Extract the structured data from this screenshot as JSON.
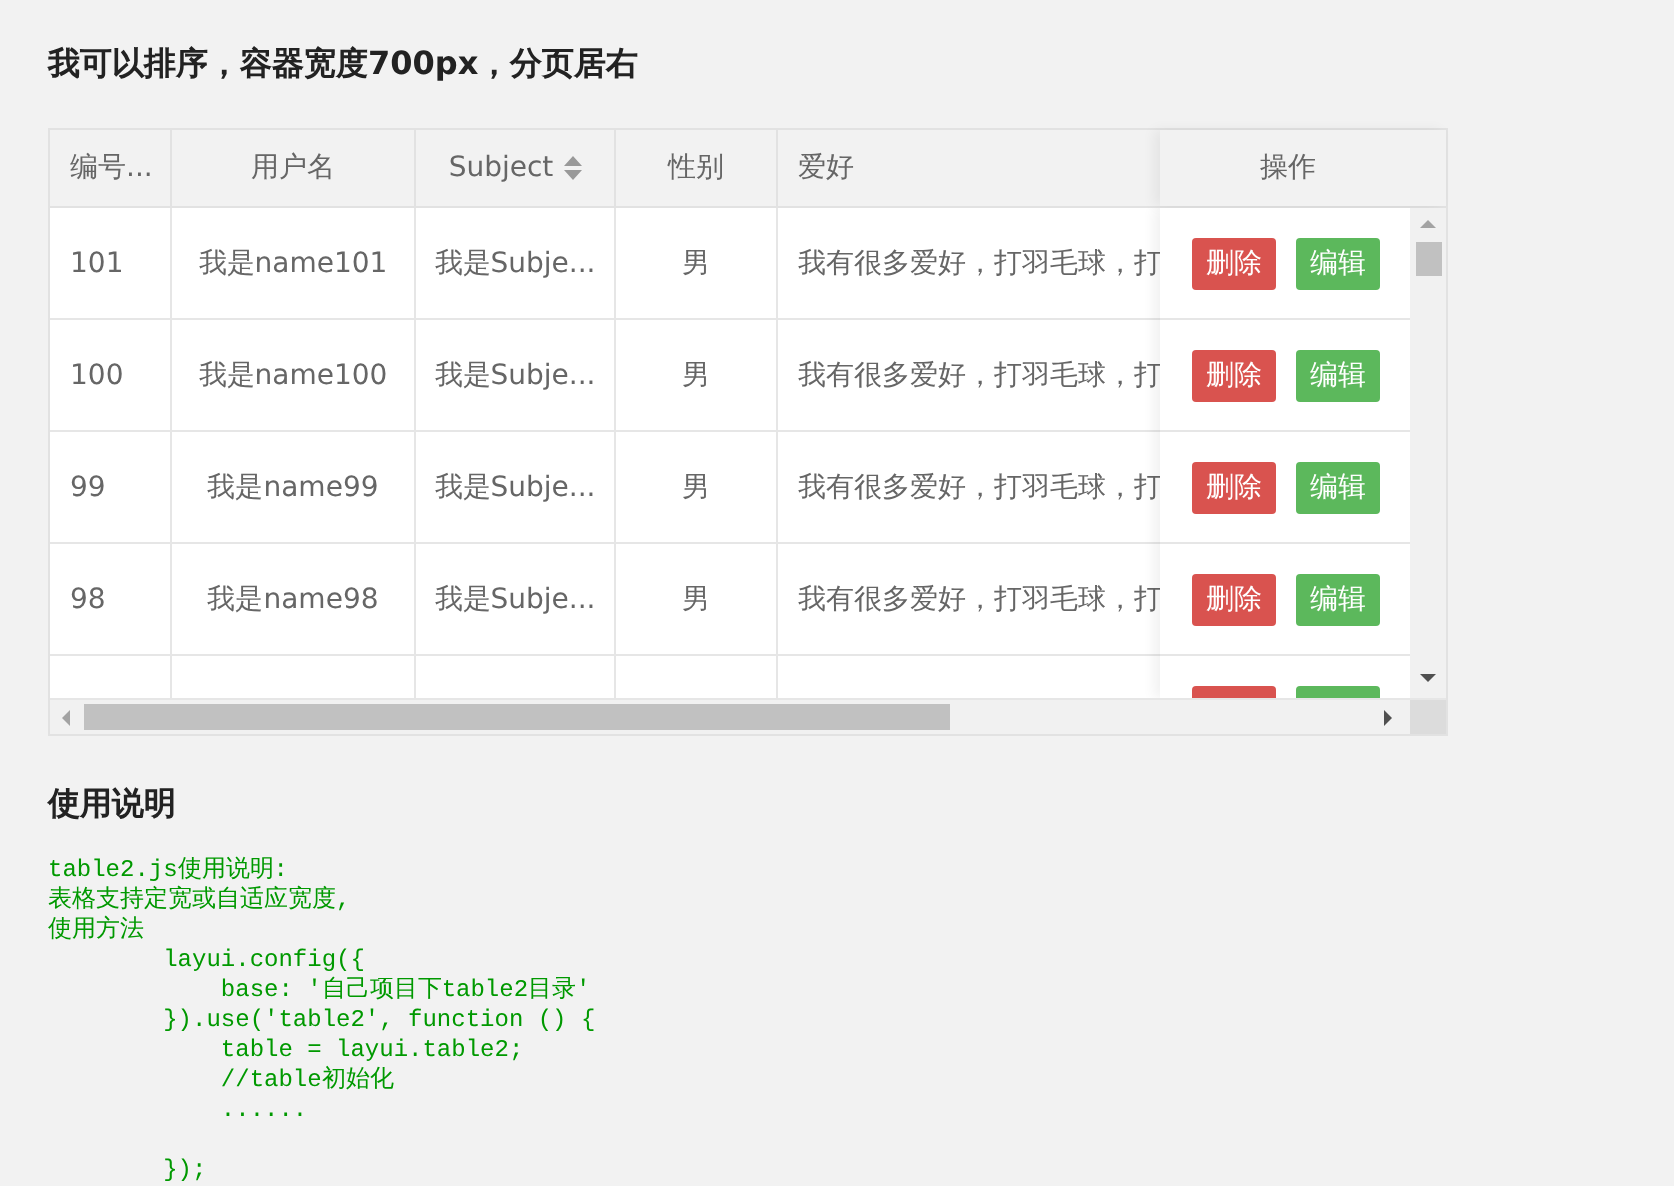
{
  "title": "我可以排序，容器宽度700px，分页居右",
  "table": {
    "columns": [
      {
        "label": "编号..."
      },
      {
        "label": "用户名"
      },
      {
        "label": "Subject",
        "sortable": true
      },
      {
        "label": "性别"
      },
      {
        "label": "爱好"
      }
    ],
    "action_column": {
      "label": "操作"
    },
    "rows": [
      {
        "cells": [
          "101",
          "我是name101",
          "我是Subje...",
          "男",
          "我有很多爱好，打羽毛球，打"
        ],
        "actions": [
          {
            "kind": "delete",
            "label": "删除"
          },
          {
            "kind": "edit",
            "label": "编辑"
          }
        ]
      },
      {
        "cells": [
          "100",
          "我是name100",
          "我是Subje...",
          "男",
          "我有很多爱好，打羽毛球，打"
        ],
        "actions": [
          {
            "kind": "delete",
            "label": "删除"
          },
          {
            "kind": "edit",
            "label": "编辑"
          }
        ]
      },
      {
        "cells": [
          "99",
          "我是name99",
          "我是Subje...",
          "男",
          "我有很多爱好，打羽毛球，打"
        ],
        "actions": [
          {
            "kind": "delete",
            "label": "删除"
          },
          {
            "kind": "edit",
            "label": "编辑"
          }
        ]
      },
      {
        "cells": [
          "98",
          "我是name98",
          "我是Subje...",
          "男",
          "我有很多爱好，打羽毛球，打"
        ],
        "actions": [
          {
            "kind": "delete",
            "label": "删除"
          },
          {
            "kind": "edit",
            "label": "编辑"
          }
        ]
      },
      {
        "actions": [
          {
            "kind": "delete"
          },
          {
            "kind": "edit"
          }
        ]
      }
    ]
  },
  "usage": {
    "heading": "使用说明",
    "code": "table2.js使用说明:\n表格支持定宽或自适应宽度,\n使用方法\n        layui.config({\n            base: '自己项目下table2目录'\n        }).use('table2', function () {\n            table = layui.table2;\n            //table初始化\n            ......\n\n        });"
  }
}
